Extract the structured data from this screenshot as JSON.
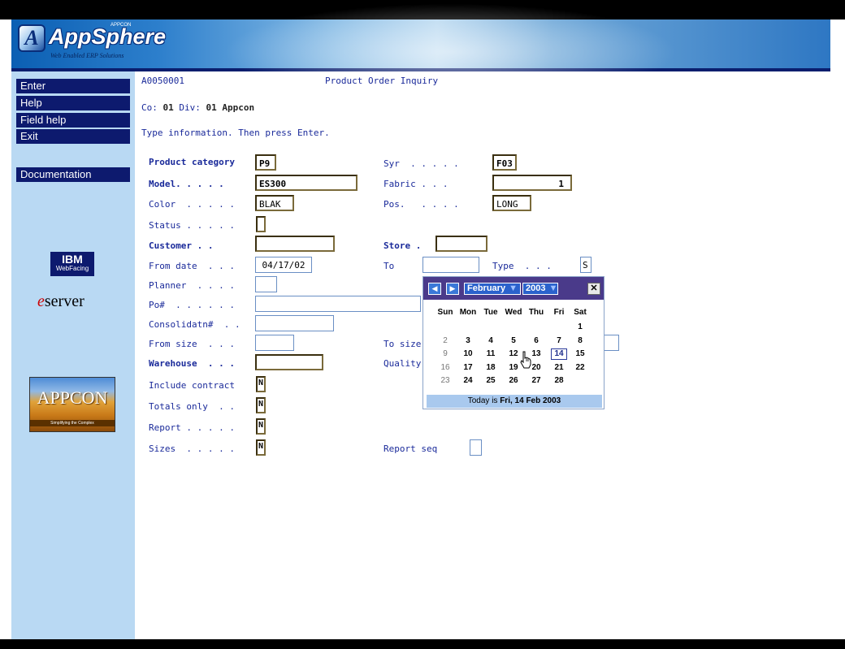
{
  "header": {
    "logo_text": "AppSphere",
    "logo_tagline": "Web Enabled ERP Solutions",
    "logo_appcon": "APPCON"
  },
  "sidebar": {
    "menu": [
      {
        "label": "Enter"
      },
      {
        "label": "Help"
      },
      {
        "label": "Field help"
      },
      {
        "label": "Exit"
      },
      {
        "label": "Documentation"
      }
    ],
    "ibm_logo": "IBM",
    "ibm_sub": "WebFacing",
    "eserver_e": "e",
    "eserver_text": "server",
    "appcon_title": "APPCON",
    "appcon_sub": "Simplifying the Complex"
  },
  "screen": {
    "program_id": "A0050001",
    "title": "Product Order Inquiry",
    "company_line_prefix": "Co:",
    "company": "01",
    "div_label": "Div:",
    "div": "01",
    "div_name": "Appcon",
    "instruction": "Type information. Then press Enter."
  },
  "fields": {
    "product_category": {
      "label": "Product category",
      "value": "P9"
    },
    "syr": {
      "label": "Syr  . . . . .",
      "value": "F03"
    },
    "model": {
      "label": "Model. . . . .",
      "value": "ES300"
    },
    "fabric": {
      "label": "Fabric . . .",
      "value": "1"
    },
    "color": {
      "label": "Color  . . . . .",
      "value": "BLAK"
    },
    "pos": {
      "label": "Pos.   . . . .",
      "value": "LONG"
    },
    "status": {
      "label": "Status . . . . .",
      "value": ""
    },
    "customer": {
      "label": "Customer . .",
      "value": ""
    },
    "store": {
      "label": "Store .",
      "value": ""
    },
    "from_date": {
      "label": "From date  . . .",
      "value": "04/17/02"
    },
    "to": {
      "label": "To",
      "value": ""
    },
    "type": {
      "label": "Type  . . .",
      "value": "S"
    },
    "planner": {
      "label": "Planner  . . . .",
      "value": ""
    },
    "po": {
      "label": "Po#  . . . . . .",
      "value": ""
    },
    "consolidatn": {
      "label": "Consolidatn#  . .",
      "value": ""
    },
    "from_size": {
      "label": "From size  . . .",
      "value": ""
    },
    "to_size": {
      "label": "To size",
      "value": ""
    },
    "warehouse": {
      "label": "Warehouse  . . .",
      "value": ""
    },
    "quality": {
      "label": "Quality",
      "value": ""
    },
    "include_contract": {
      "label": "Include contract",
      "value": "N"
    },
    "totals_only": {
      "label": "Totals only  . .",
      "value": "N"
    },
    "report": {
      "label": "Report . . . . .",
      "value": "N"
    },
    "sizes": {
      "label": "Sizes  . . . . .",
      "value": "N"
    },
    "report_seq": {
      "label": "Report seq",
      "value": ""
    }
  },
  "calendar": {
    "prev": "◀",
    "next": "▶",
    "month": "February",
    "year": "2003",
    "close": "✕",
    "dow": [
      "Sun",
      "Mon",
      "Tue",
      "Wed",
      "Thu",
      "Fri",
      "Sat"
    ],
    "weeks": [
      [
        "",
        "",
        "",
        "",
        "",
        "",
        "1"
      ],
      [
        "2",
        "3",
        "4",
        "5",
        "6",
        "7",
        "8"
      ],
      [
        "9",
        "10",
        "11",
        "12",
        "13",
        "14",
        "15"
      ],
      [
        "16",
        "17",
        "18",
        "19",
        "20",
        "21",
        "22"
      ],
      [
        "23",
        "24",
        "25",
        "26",
        "27",
        "28",
        ""
      ]
    ],
    "today_day": "14",
    "footer_prefix": "Today is ",
    "footer_date": "Fri, 14 Feb 2003"
  }
}
